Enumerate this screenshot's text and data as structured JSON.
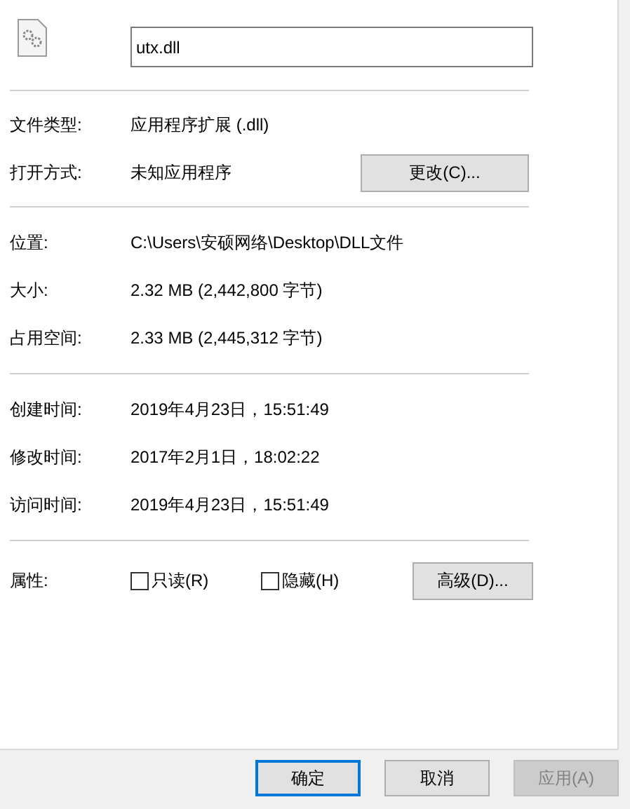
{
  "file_name": "utx.dll",
  "type_section": [
    {
      "label": "文件类型:",
      "value": "应用程序扩展 (.dll)"
    },
    {
      "label": "打开方式:",
      "value": "未知应用程序",
      "button": "更改(C)..."
    }
  ],
  "location_section": [
    {
      "label": "位置:",
      "value": "C:\\Users\\安硕网络\\Desktop\\DLL文件"
    },
    {
      "label": "大小:",
      "value": "2.32 MB (2,442,800 字节)"
    },
    {
      "label": "占用空间:",
      "value": "2.33 MB (2,445,312 字节)"
    }
  ],
  "time_section": [
    {
      "label": "创建时间:",
      "value": "2019年4月23日，15:51:49"
    },
    {
      "label": "修改时间:",
      "value": "2017年2月1日，18:02:22"
    },
    {
      "label": "访问时间:",
      "value": "2019年4月23日，15:51:49"
    }
  ],
  "attributes": {
    "label": "属性:",
    "checkboxes": [
      {
        "label": "只读(R)",
        "checked": false
      },
      {
        "label": "隐藏(H)",
        "checked": false
      }
    ],
    "button": "高级(D)..."
  },
  "footer_buttons": [
    {
      "label": "确定",
      "default": true,
      "disabled": false
    },
    {
      "label": "取消",
      "default": false,
      "disabled": false
    },
    {
      "label": "应用(A)",
      "default": false,
      "disabled": true
    }
  ]
}
